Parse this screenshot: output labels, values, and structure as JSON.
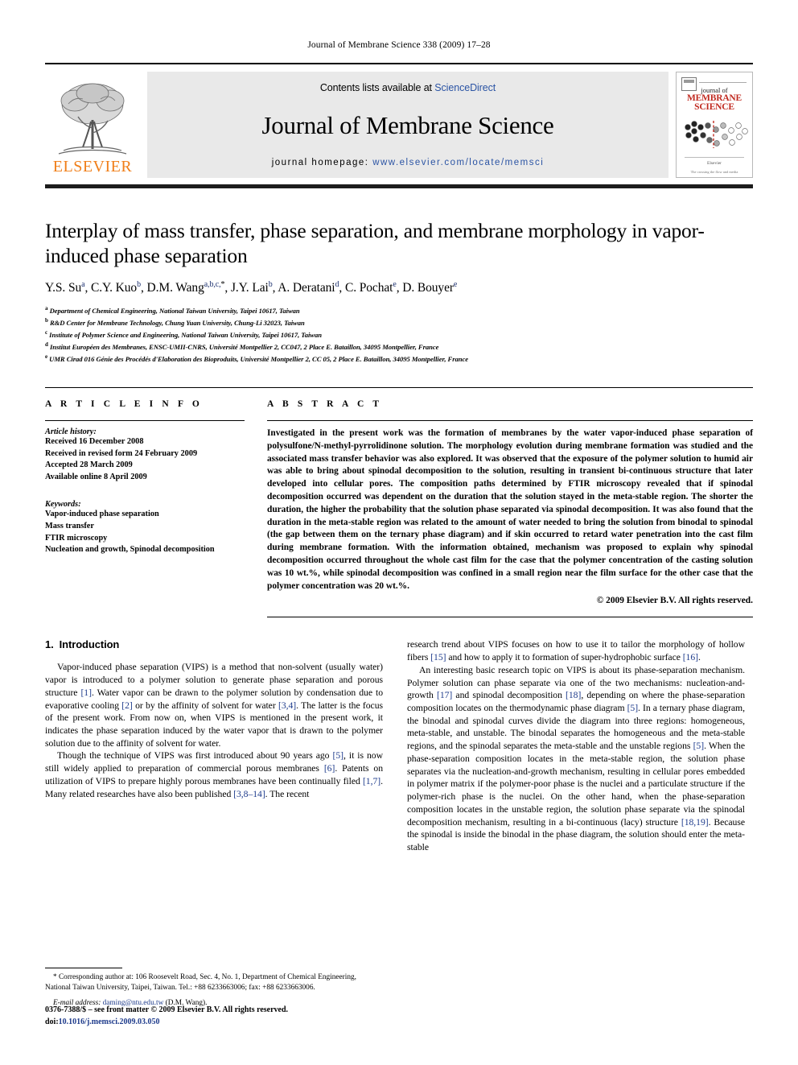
{
  "running_head": "Journal of Membrane Science 338 (2009) 17–28",
  "masthead": {
    "publisher_name": "ELSEVIER",
    "contents_prefix": "Contents lists available at ",
    "contents_link": "ScienceDirect",
    "journal_title": "Journal of Membrane Science",
    "homepage_prefix": "journal homepage: ",
    "homepage_url": "www.elsevier.com/locate/memsci",
    "cover": {
      "line1": "journal of",
      "line2": "MEMBRANE",
      "line3": "SCIENCE",
      "footer1": "Elsevier",
      "footer2": "The crossing the flow and media"
    }
  },
  "article": {
    "title": "Interplay of mass transfer, phase separation, and membrane morphology in vapor-induced phase separation",
    "authors_html": "Y.S. Su<sup>a</sup>, C.Y. Kuo<sup>b</sup>, D.M. Wang<sup>a,b,c,</sup><sup class=\"star\">*</sup>, J.Y. Lai<sup>b</sup>, A. Deratani<sup>d</sup>, C. Pochat<sup>e</sup>, D. Bouyer<sup>e</sup>",
    "affiliations": [
      {
        "mark": "a",
        "text": "Department of Chemical Engineering, National Taiwan University, Taipei 10617, Taiwan"
      },
      {
        "mark": "b",
        "text": "R&D Center for Membrane Technology, Chung Yuan University, Chung-Li 32023, Taiwan"
      },
      {
        "mark": "c",
        "text": "Institute of Polymer Science and Engineering, National Taiwan University, Taipei 10617, Taiwan"
      },
      {
        "mark": "d",
        "text": "Institut Européen des Membranes, ENSC-UMII-CNRS, Université Montpellier 2, CC047, 2 Place E. Bataillon, 34095 Montpellier, France"
      },
      {
        "mark": "e",
        "text": "UMR Cirad 016 Génie des Procédés d'Elaboration des Bioproduits, Université Montpellier 2, CC 05, 2 Place E. Bataillon, 34095 Montpellier, France"
      }
    ]
  },
  "article_info": {
    "heading": "A R T I C L E    I N F O",
    "history_label": "Article history:",
    "history": [
      "Received 16 December 2008",
      "Received in revised form 24 February 2009",
      "Accepted 28 March 2009",
      "Available online 8 April 2009"
    ],
    "keywords_label": "Keywords:",
    "keywords": [
      "Vapor-induced phase separation",
      "Mass transfer",
      "FTIR microscopy",
      "Nucleation and growth, Spinodal decomposition"
    ]
  },
  "abstract": {
    "heading": "A B S T R A C T",
    "text": "Investigated in the present work was the formation of membranes by the water vapor-induced phase separation of polysulfone/N-methyl-pyrrolidinone solution. The morphology evolution during membrane formation was studied and the associated mass transfer behavior was also explored. It was observed that the exposure of the polymer solution to humid air was able to bring about spinodal decomposition to the solution, resulting in transient bi-continuous structure that later developed into cellular pores. The composition paths determined by FTIR microscopy revealed that if spinodal decomposition occurred was dependent on the duration that the solution stayed in the meta-stable region. The shorter the duration, the higher the probability that the solution phase separated via spinodal decomposition. It was also found that the duration in the meta-stable region was related to the amount of water needed to bring the solution from binodal to spinodal (the gap between them on the ternary phase diagram) and if skin occurred to retard water penetration into the cast film during membrane formation. With the information obtained, mechanism was proposed to explain why spinodal decomposition occurred throughout the whole cast film for the case that the polymer concentration of the casting solution was 10 wt.%, while spinodal decomposition was confined in a small region near the film surface for the other case that the polymer concentration was 20 wt.%.",
    "copyright": "© 2009 Elsevier B.V. All rights reserved."
  },
  "introduction": {
    "number": "1.",
    "title": "Introduction",
    "left_paragraphs": [
      "Vapor-induced phase separation (VIPS) is a method that non-solvent (usually water) vapor is introduced to a polymer solution to generate phase separation and porous structure [1]. Water vapor can be drawn to the polymer solution by condensation due to evaporative cooling [2] or by the affinity of solvent for water [3,4]. The latter is the focus of the present work. From now on, when VIPS is mentioned in the present work, it indicates the phase separation induced by the water vapor that is drawn to the polymer solution due to the affinity of solvent for water.",
      "Though the technique of VIPS was first introduced about 90 years ago [5], it is now still widely applied to preparation of commercial porous membranes [6]. Patents on utilization of VIPS to prepare highly porous membranes have been continually filed [1,7]. Many related researches have also been published [3,8–14]. The recent"
    ],
    "right_paragraphs": [
      "research trend about VIPS focuses on how to use it to tailor the morphology of hollow fibers [15] and how to apply it to formation of super-hydrophobic surface [16].",
      "An interesting basic research topic on VIPS is about its phase-separation mechanism. Polymer solution can phase separate via one of the two mechanisms: nucleation-and-growth [17] and spinodal decomposition [18], depending on where the phase-separation composition locates on the thermodynamic phase diagram [5]. In a ternary phase diagram, the binodal and spinodal curves divide the diagram into three regions: homogeneous, meta-stable, and unstable. The binodal separates the homogeneous and the meta-stable regions, and the spinodal separates the meta-stable and the unstable regions [5]. When the phase-separation composition locates in the meta-stable region, the solution phase separates via the nucleation-and-growth mechanism, resulting in cellular pores embedded in polymer matrix if the polymer-poor phase is the nuclei and a particulate structure if the polymer-rich phase is the nuclei. On the other hand, when the phase-separation composition locates in the unstable region, the solution phase separate via the spinodal decomposition mechanism, resulting in a bi-continuous (lacy) structure [18,19]. Because the spinodal is inside the binodal in the phase diagram, the solution should enter the meta-stable"
    ]
  },
  "footnote": {
    "corresponding": "* Corresponding author at: 106 Roosevelt Road, Sec. 4, No. 1, Department of Chemical Engineering, National Taiwan University, Taipei, Taiwan. Tel.: +88 6233663006; fax: +88 6233663006.",
    "email_label": "E-mail address:",
    "email": "daming@ntu.edu.tw",
    "email_suffix": "(D.M. Wang)."
  },
  "imprint": {
    "line1": "0376-7388/$ – see front matter © 2009 Elsevier B.V. All rights reserved.",
    "doi_label": "doi:",
    "doi": "10.1016/j.memsci.2009.03.050"
  },
  "colors": {
    "link": "#1f3c8c",
    "elsevier_orange": "#F07F1A",
    "cover_red": "#c02a20",
    "band_grey": "#e9e9e9"
  }
}
